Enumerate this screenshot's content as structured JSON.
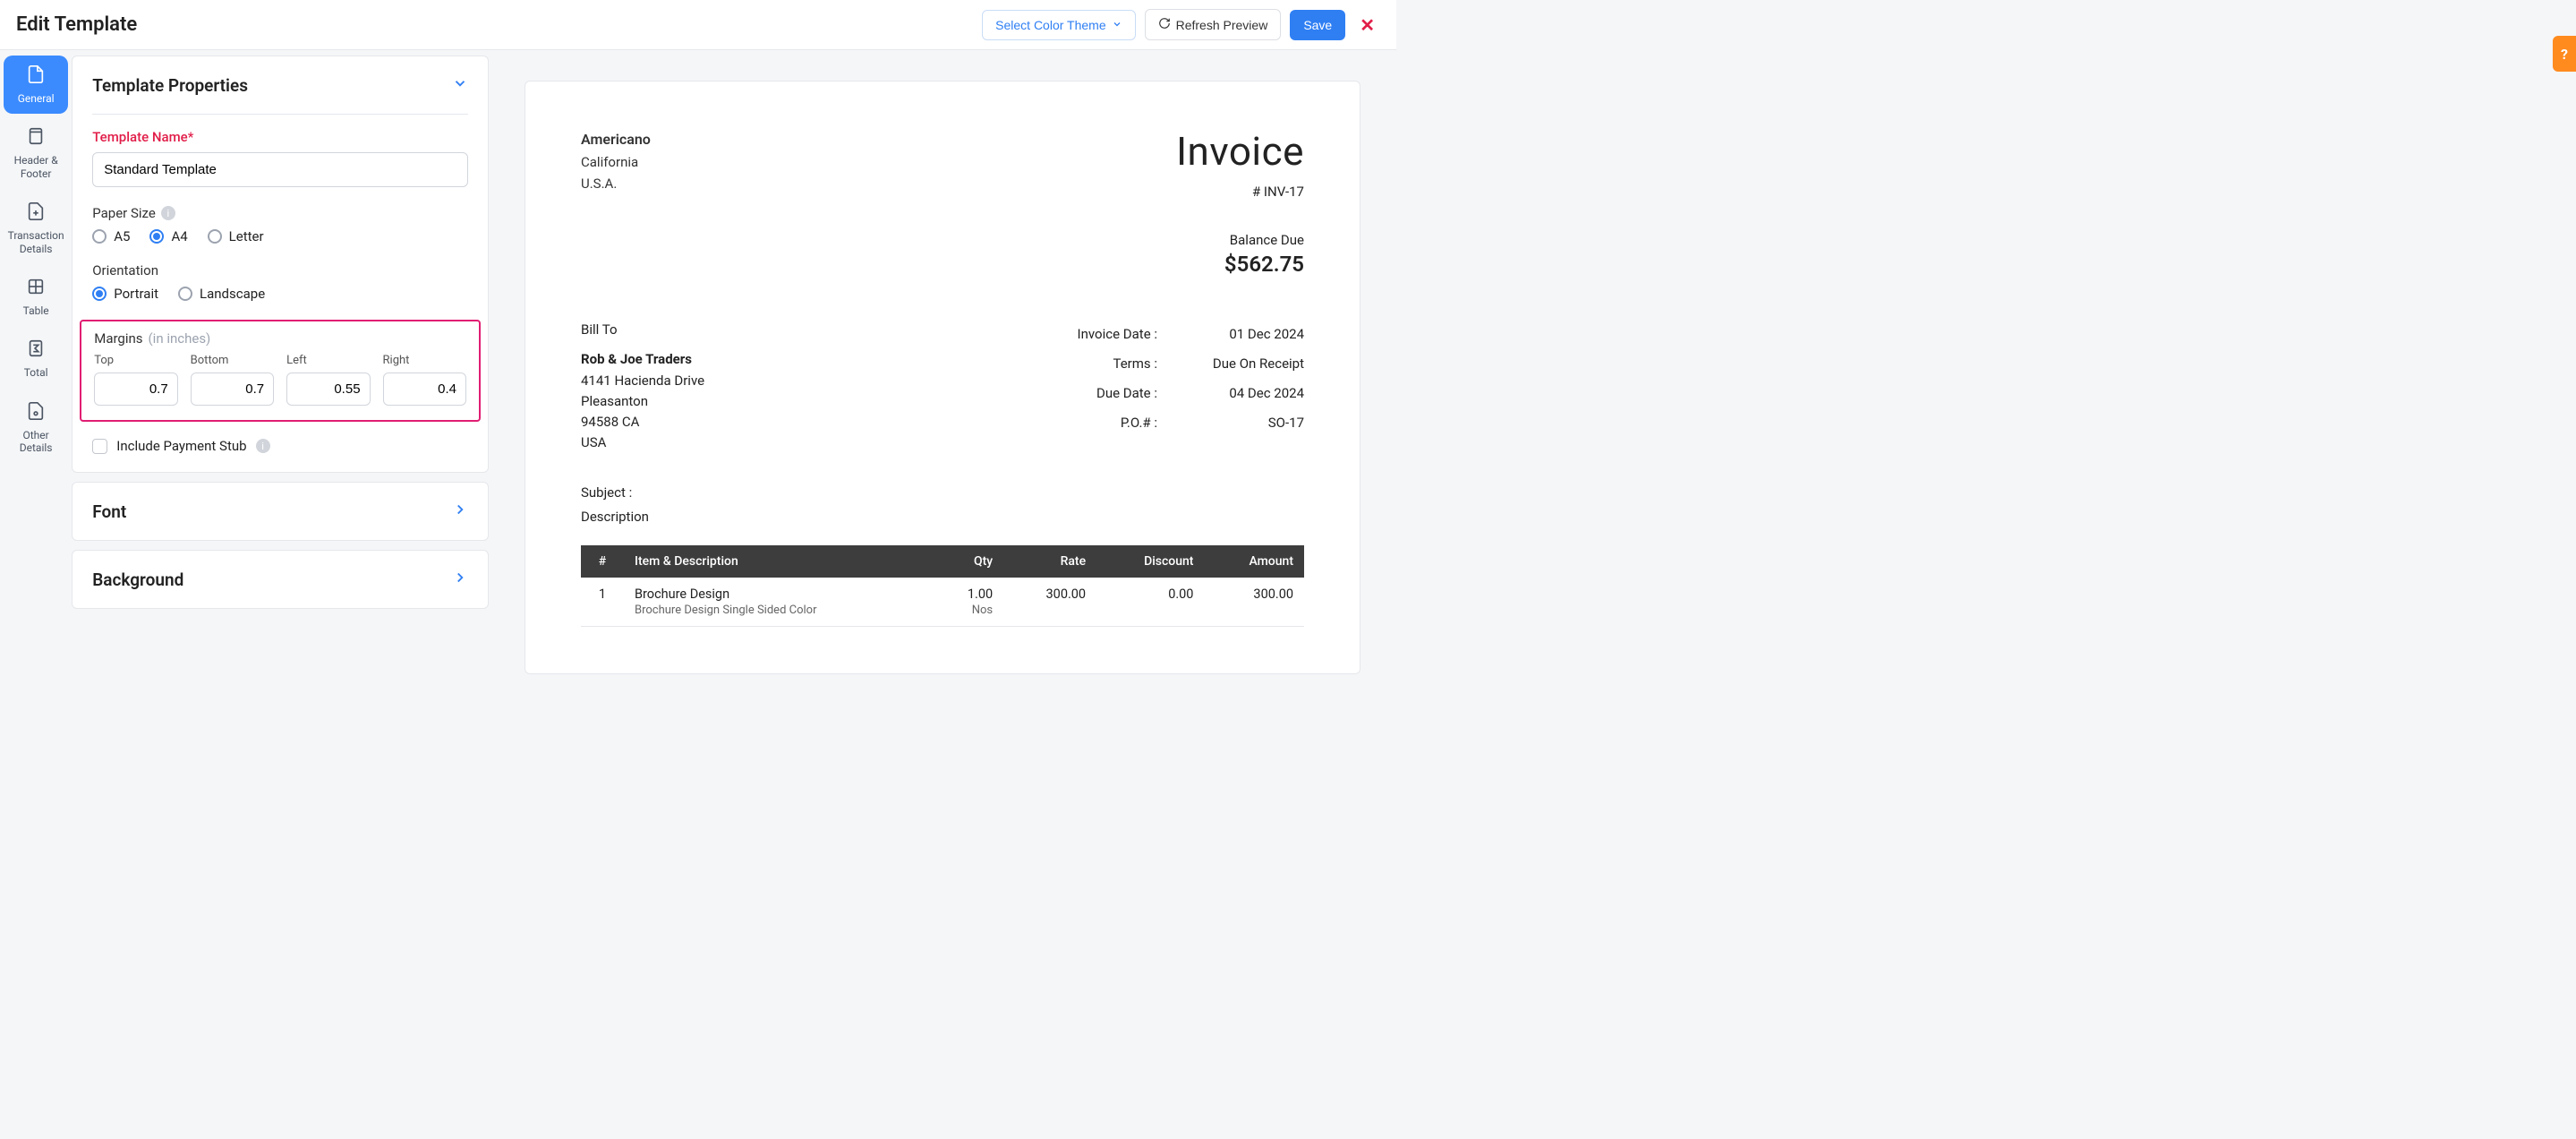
{
  "header": {
    "title": "Edit Template",
    "colorTheme": "Select Color Theme",
    "refresh": "Refresh Preview",
    "save": "Save"
  },
  "rail": {
    "general": "General",
    "headerFooter": "Header & Footer",
    "transactionDetails": "Transaction Details",
    "table": "Table",
    "total": "Total",
    "otherDetails": "Other Details"
  },
  "sections": {
    "templateProps": "Template Properties",
    "font": "Font",
    "background": "Background"
  },
  "form": {
    "templateNameLabel": "Template Name*",
    "templateNameValue": "Standard Template",
    "paperSizeLabel": "Paper Size",
    "paperSizes": {
      "a5": "A5",
      "a4": "A4",
      "letter": "Letter"
    },
    "orientationLabel": "Orientation",
    "orientations": {
      "portrait": "Portrait",
      "landscape": "Landscape"
    },
    "marginsLabel": "Margins",
    "marginsHint": "(in inches)",
    "margins": {
      "topLabel": "Top",
      "top": "0.7",
      "bottomLabel": "Bottom",
      "bottom": "0.7",
      "leftLabel": "Left",
      "left": "0.55",
      "rightLabel": "Right",
      "right": "0.4"
    },
    "includePaymentStub": "Include Payment Stub"
  },
  "preview": {
    "from": {
      "name": "Americano",
      "line1": "California",
      "line2": "U.S.A."
    },
    "docTitle": "Invoice",
    "docNumber": "# INV-17",
    "balanceLabel": "Balance Due",
    "balanceAmount": "$562.75",
    "billToLabel": "Bill To",
    "billTo": {
      "name": "Rob & Joe Traders",
      "street": "4141 Hacienda Drive",
      "city": "Pleasanton",
      "zipState": "94588 CA",
      "country": "USA"
    },
    "meta": {
      "invoiceDateLabel": "Invoice Date :",
      "invoiceDate": "01 Dec 2024",
      "termsLabel": "Terms :",
      "terms": "Due On Receipt",
      "dueDateLabel": "Due Date :",
      "dueDate": "04 Dec 2024",
      "poLabel": "P.O.# :",
      "po": "SO-17"
    },
    "subjectLabel": "Subject :",
    "subjectValue": "Description",
    "columns": {
      "idx": "#",
      "item": "Item & Description",
      "qty": "Qty",
      "rate": "Rate",
      "discount": "Discount",
      "amount": "Amount"
    },
    "rows": [
      {
        "idx": "1",
        "name": "Brochure Design",
        "desc": "Brochure Design Single Sided Color",
        "qty": "1.00",
        "unit": "Nos",
        "rate": "300.00",
        "discount": "0.00",
        "amount": "300.00"
      }
    ]
  }
}
